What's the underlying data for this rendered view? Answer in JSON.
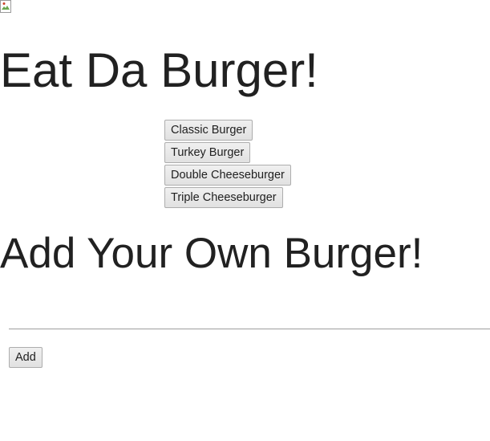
{
  "header": {
    "logo_icon": "broken-image-icon",
    "title": "Eat Da Burger!"
  },
  "burgers": [
    {
      "label": "Classic Burger"
    },
    {
      "label": "Turkey Burger"
    },
    {
      "label": "Double Cheeseburger"
    },
    {
      "label": "Triple Cheeseburger"
    }
  ],
  "add_form": {
    "heading": "Add Your Own Burger!",
    "input_value": "",
    "input_placeholder": "",
    "submit_label": "Add"
  }
}
